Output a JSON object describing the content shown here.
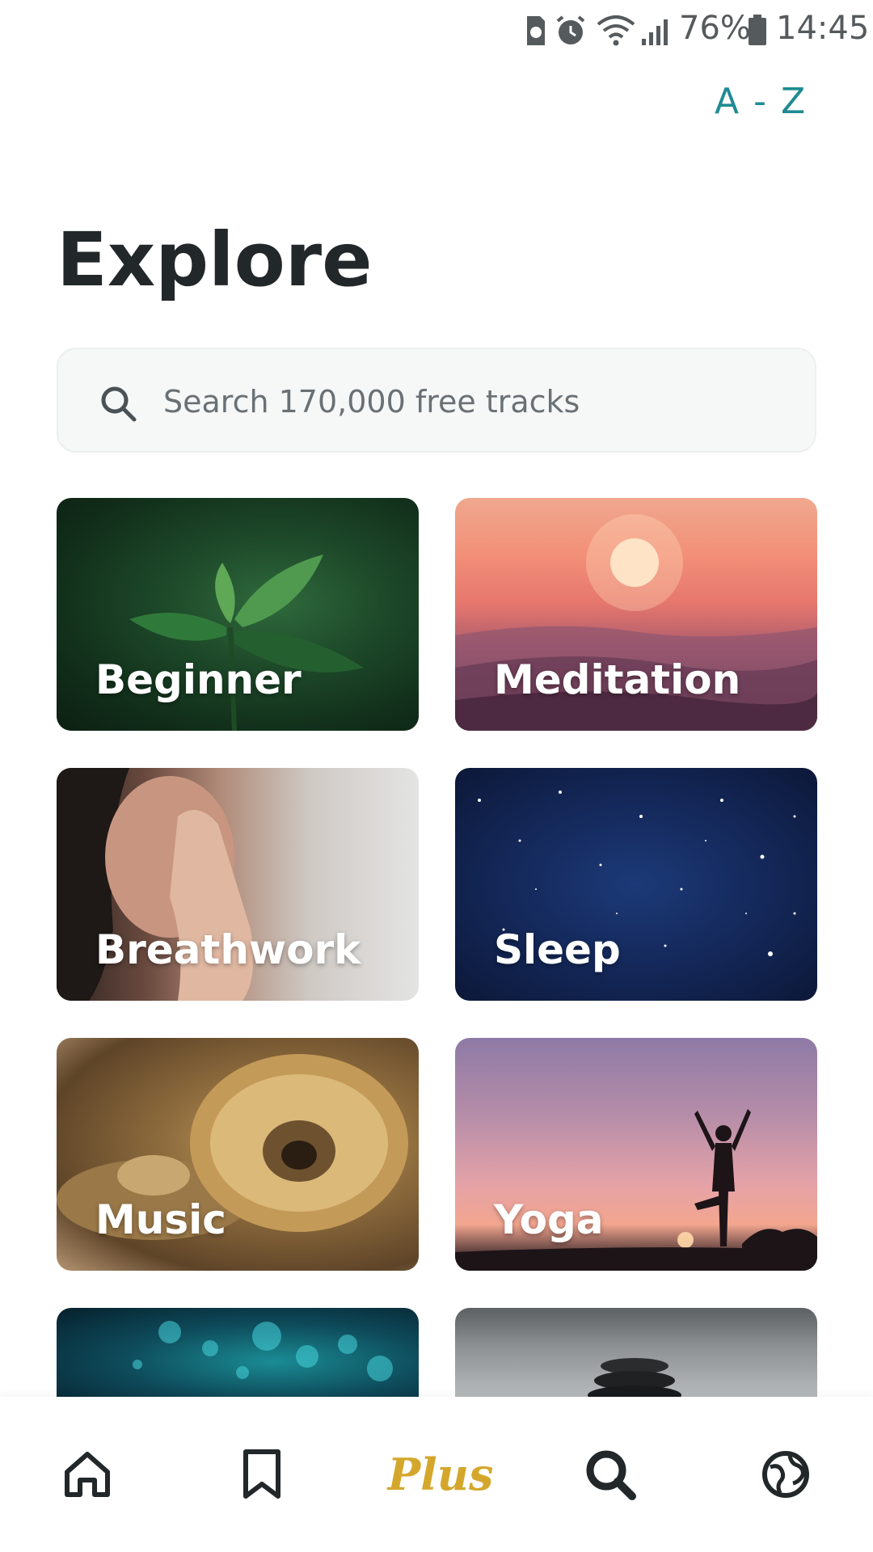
{
  "status_bar": {
    "battery_percent": "76%",
    "time": "14:45",
    "icons": [
      "sim-icon",
      "alarm-icon",
      "wifi-icon",
      "signal-icon",
      "battery-icon"
    ]
  },
  "header": {
    "az_label": "A - Z",
    "title": "Explore"
  },
  "search": {
    "placeholder": "Search 170,000 free tracks"
  },
  "categories": [
    {
      "label": "Beginner"
    },
    {
      "label": "Meditation"
    },
    {
      "label": "Breathwork"
    },
    {
      "label": "Sleep"
    },
    {
      "label": "Music"
    },
    {
      "label": "Yoga"
    }
  ],
  "bottom_nav": {
    "items": [
      {
        "icon": "home-icon"
      },
      {
        "icon": "bookmark-icon"
      },
      {
        "label": "Plus"
      },
      {
        "icon": "search-icon",
        "active": true
      },
      {
        "icon": "globe-icon"
      }
    ]
  },
  "colors": {
    "accent": "#1f8b93",
    "plus": "#d4a72c",
    "text": "#22272a"
  }
}
